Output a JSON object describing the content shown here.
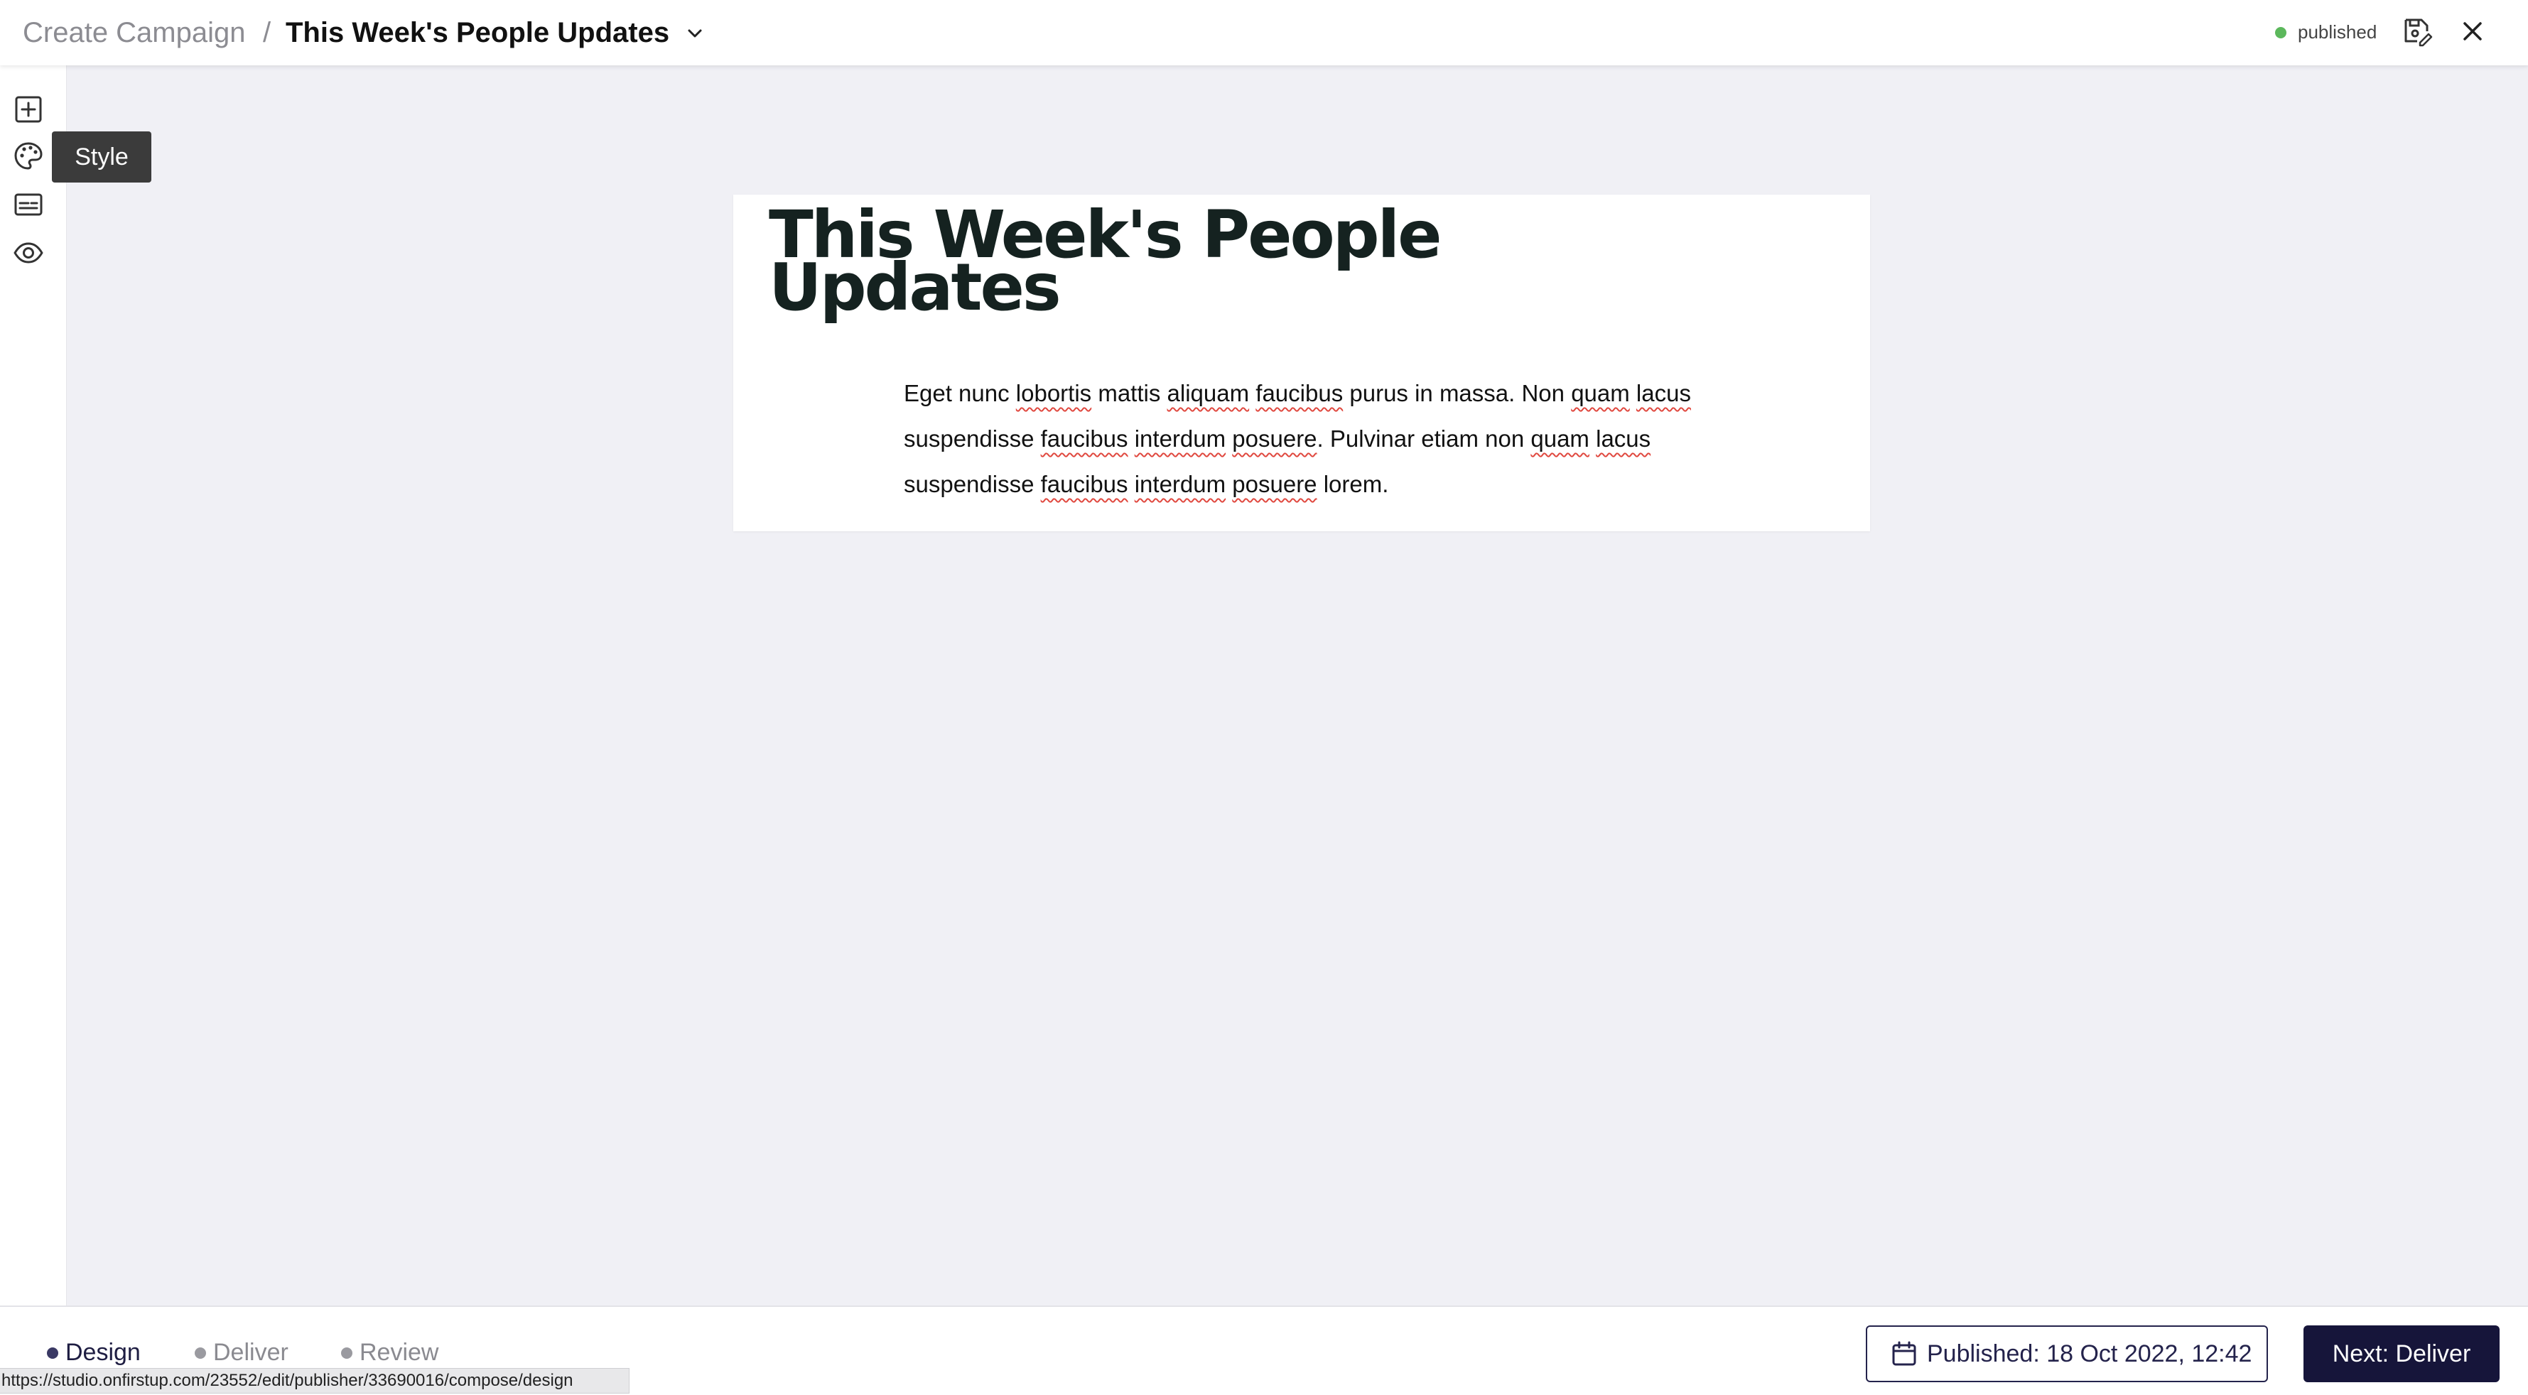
{
  "header": {
    "breadcrumb_parent": "Create Campaign",
    "breadcrumb_separator": "/",
    "title": "This Week's People Updates",
    "status": "published",
    "status_color": "#5cb85c"
  },
  "toolbar": {
    "items": [
      {
        "icon": "add-block-icon"
      },
      {
        "icon": "palette-icon"
      },
      {
        "icon": "caption-icon"
      },
      {
        "icon": "eye-icon"
      }
    ],
    "tooltip": "Style"
  },
  "canvas": {
    "title_line1": "This Week's People",
    "title_line2": "Updates",
    "body": {
      "line1": {
        "pre": "Eget nunc ",
        "w1": "lobortis",
        "m1": " mattis ",
        "w2": "aliquam",
        "m2": " ",
        "w3": "faucibus",
        "m3": " purus in massa. Non ",
        "w4": "quam",
        "m4": " ",
        "w5": "lacus"
      },
      "line2": {
        "pre": "suspendisse ",
        "w1": "faucibus",
        "m1": " ",
        "w2": "interdum",
        "m2": " ",
        "w3": "posuere",
        "m3": ". Pulvinar etiam non ",
        "w4": "quam",
        "m4": " ",
        "w5": "lacus"
      },
      "line3": {
        "pre": "suspendisse ",
        "w1": "faucibus",
        "m1": " ",
        "w2": "interdum",
        "m2": " ",
        "w3": "posuere",
        "post": " lorem."
      }
    }
  },
  "footer": {
    "steps": [
      {
        "label": "Design",
        "active": true
      },
      {
        "label": "Deliver",
        "active": false
      },
      {
        "label": "Review",
        "active": false
      }
    ],
    "published_label": "Published: 18 Oct 2022, 12:42",
    "next_label": "Next: Deliver",
    "accent_color": "#16153a"
  },
  "status_url": "https://studio.onfirstup.com/23552/edit/publisher/33690016/compose/design"
}
